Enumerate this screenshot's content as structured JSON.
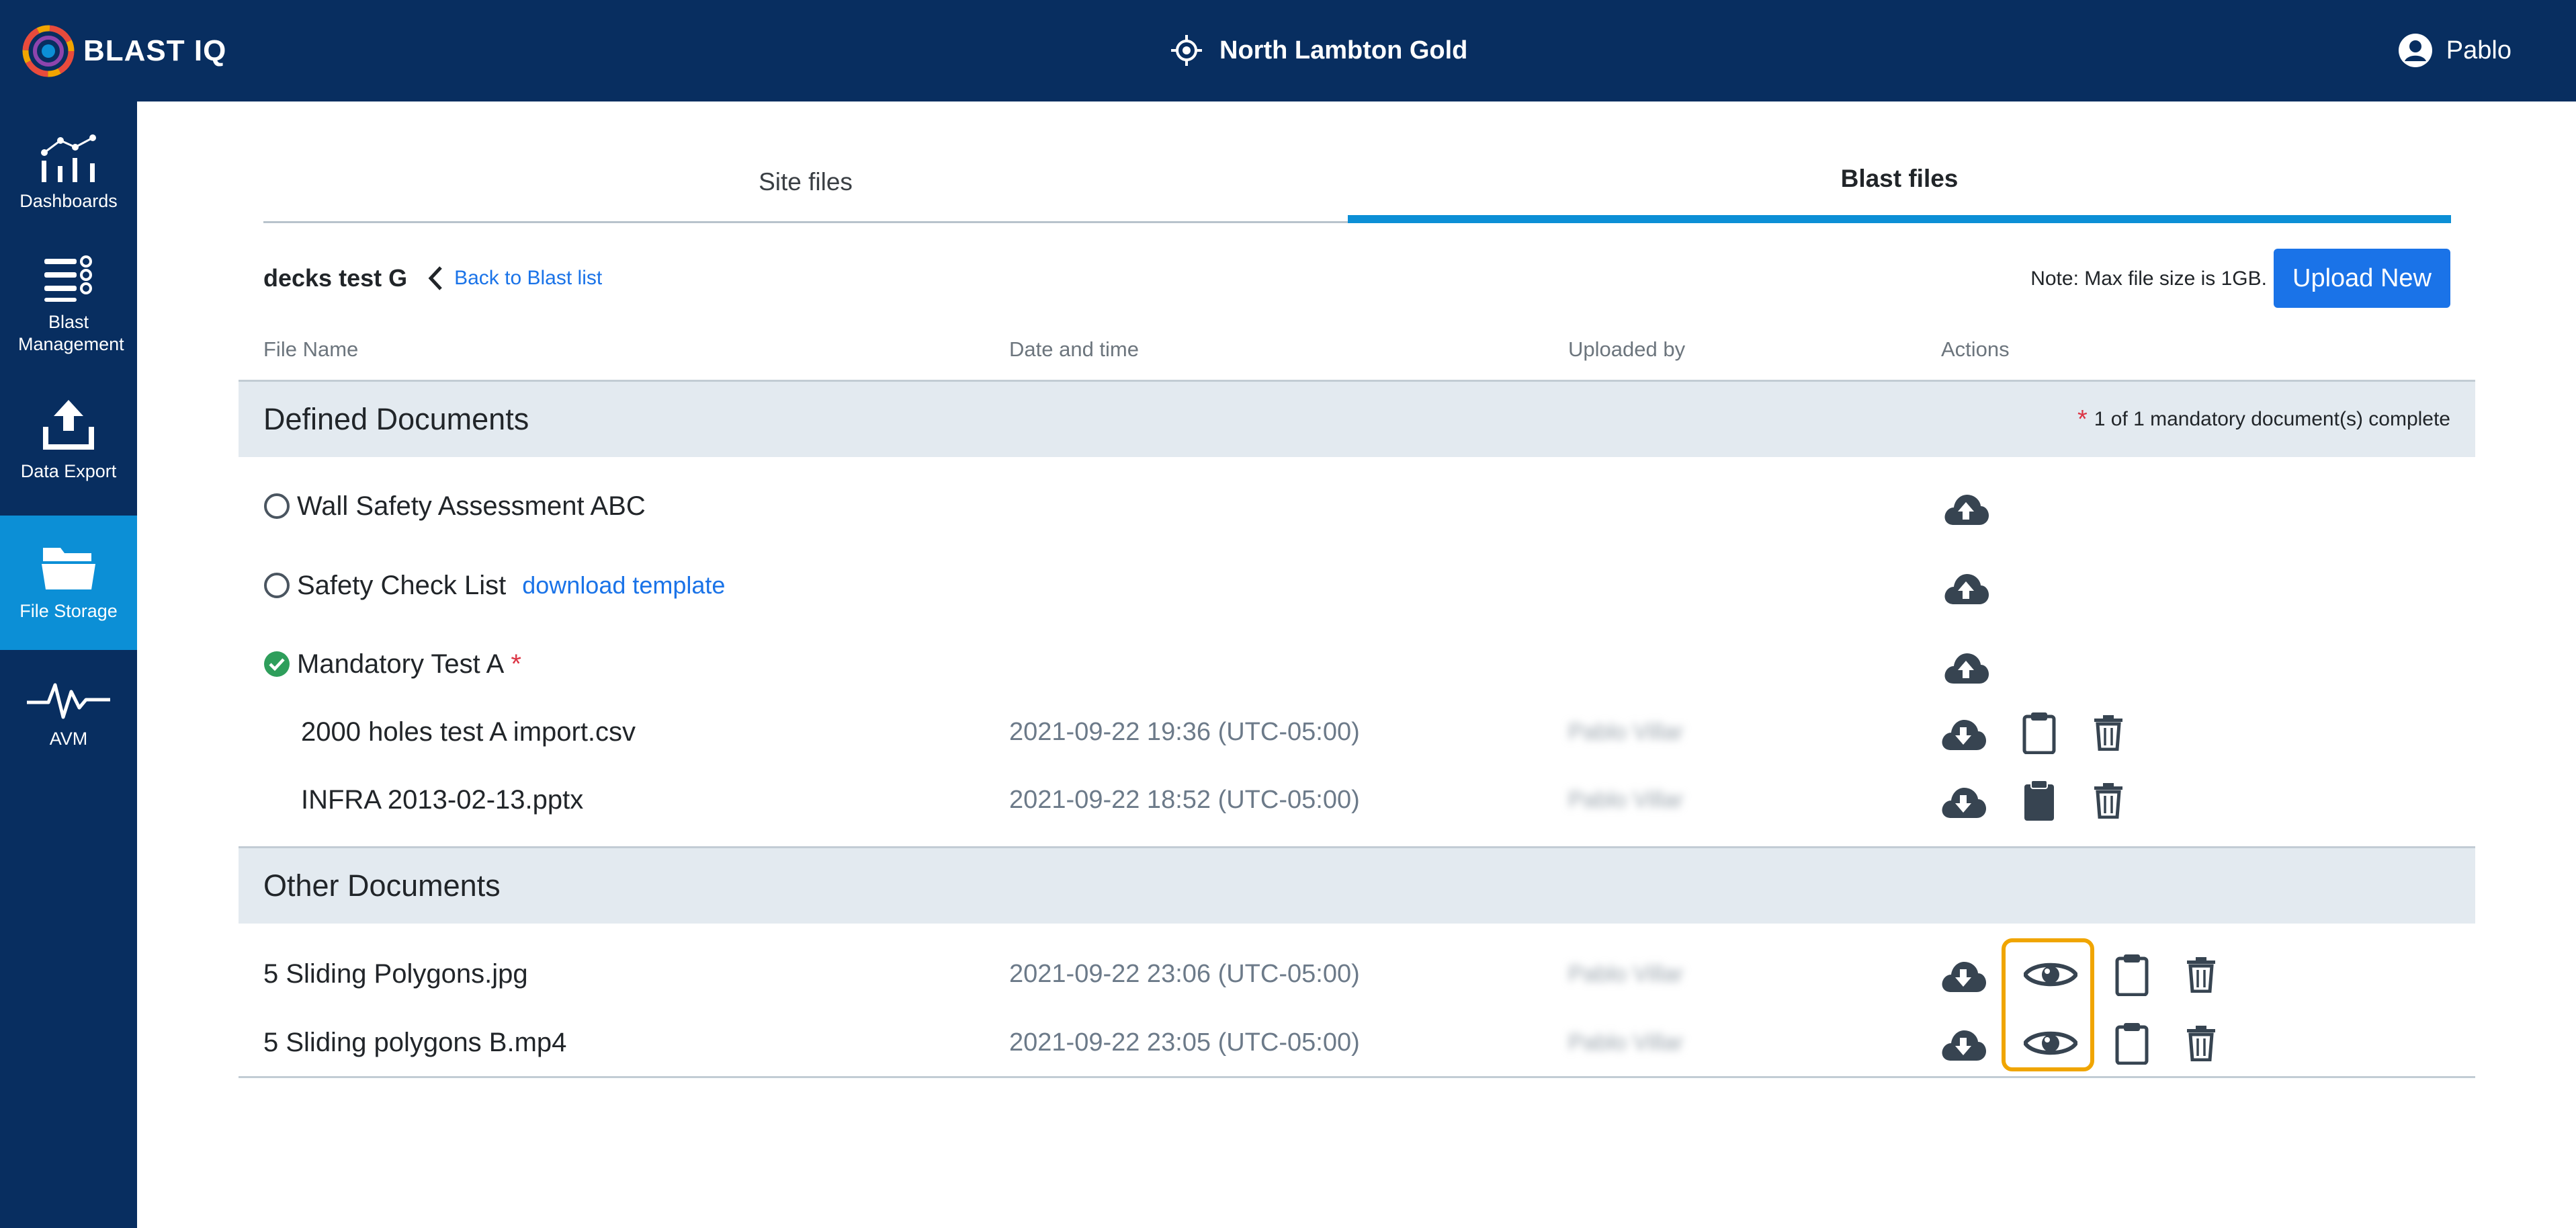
{
  "app": {
    "logo_text": "BLAST IQ",
    "site_name": "North Lambton Gold",
    "user_name": "Pablo",
    "colors": {
      "navy": "#082e60",
      "accent": "#0c8fd6",
      "link": "#1a73e8",
      "highlight": "#f0a500",
      "success": "#2e9e5b"
    }
  },
  "sidebar": {
    "items": [
      {
        "label": "Dashboards",
        "icon": "chart-icon"
      },
      {
        "label": "Blast Management",
        "icon": "list-icon"
      },
      {
        "label": "Data Export",
        "icon": "upload-tray-icon"
      },
      {
        "label": "File Storage",
        "icon": "folder-open-icon",
        "active": true
      },
      {
        "label": "AVM",
        "icon": "waveform-icon"
      }
    ]
  },
  "tabs": [
    {
      "label": "Site files",
      "active": false
    },
    {
      "label": "Blast files",
      "active": true
    }
  ],
  "header": {
    "blast_name": "decks test G",
    "back_label": "Back to Blast list",
    "note": "Note: Max file size is 1GB.",
    "upload_label": "Upload New"
  },
  "columns": [
    "File Name",
    "Date and time",
    "Uploaded by",
    "Actions"
  ],
  "defined": {
    "title": "Defined Documents",
    "mandatory_star": "*",
    "mandatory_status": "1 of 1 mandatory document(s) complete",
    "documents": [
      {
        "name": "Wall Safety Assessment ABC",
        "status": "empty-circle-icon"
      },
      {
        "name": "Safety Check List",
        "status": "empty-circle-icon",
        "link": "download template"
      },
      {
        "name": "Mandatory Test A",
        "status": "check-circle-icon",
        "required_star": "*"
      }
    ],
    "files": [
      {
        "name": "2000 holes test A import.csv",
        "date": "2021-09-22 19:36 (UTC-05:00)",
        "uploader": "Pablo Villar"
      },
      {
        "name": "INFRA 2013-02-13.pptx",
        "date": "2021-09-22 18:52 (UTC-05:00)",
        "uploader": "Pablo Villar"
      }
    ]
  },
  "other": {
    "title": "Other Documents",
    "files": [
      {
        "name": "5 Sliding Polygons.jpg",
        "date": "2021-09-22 23:06 (UTC-05:00)",
        "uploader": "Pablo Villar"
      },
      {
        "name": "5 Sliding polygons B.mp4",
        "date": "2021-09-22 23:05 (UTC-05:00)",
        "uploader": "Pablo Villar"
      }
    ]
  }
}
